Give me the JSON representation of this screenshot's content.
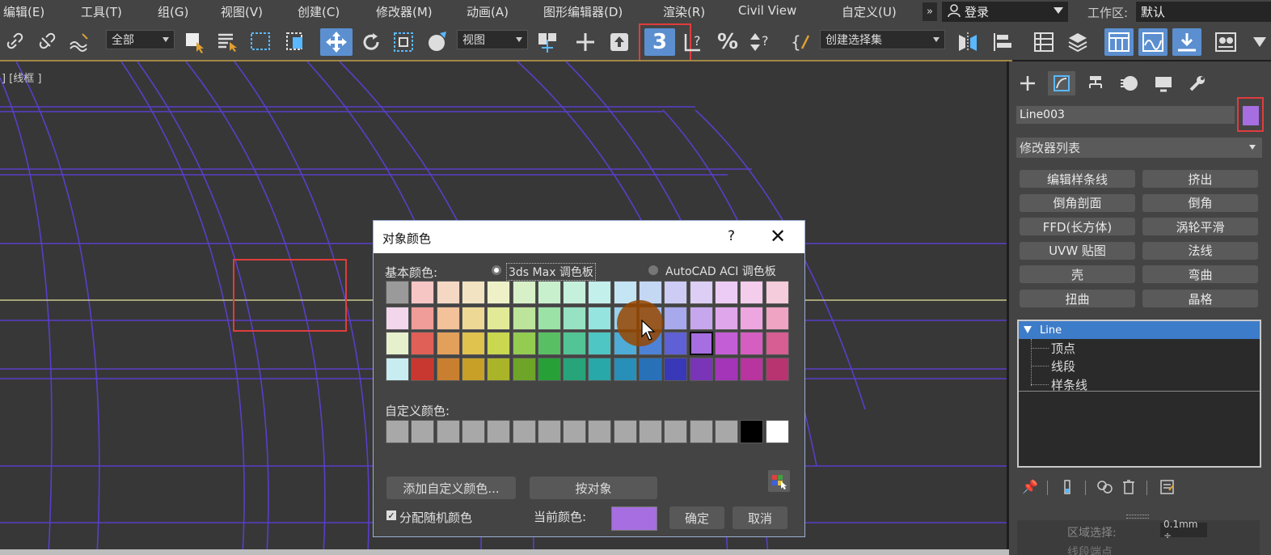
{
  "menu": {
    "items": [
      "编辑(E)",
      "工具(T)",
      "组(G)",
      "视图(V)",
      "创建(C)",
      "修改器(M)",
      "动画(A)",
      "图形编辑器(D)",
      "渲染(R)",
      "Civil View",
      "自定义(U)"
    ],
    "more": "»",
    "login": "登录",
    "workspace_label": "工作区:",
    "workspace_value": "默认"
  },
  "toolbar": {
    "filter_dropdown": "全部",
    "refcoord_dropdown": "视图",
    "selection_set_dropdown": "创建选择集",
    "snap_toggle_label": "3"
  },
  "viewport": {
    "label": "] [线框 ]"
  },
  "command_panel": {
    "object_name": "Line003",
    "object_color": "#a66ee0",
    "modifier_list": "修改器列表",
    "modifier_buttons": [
      "编辑样条线",
      "挤出",
      "倒角剖面",
      "倒角",
      "FFD(长方体)",
      "涡轮平滑",
      "UVW 贴图",
      "法线",
      "壳",
      "弯曲",
      "扭曲",
      "晶格"
    ],
    "stack": {
      "selected": "Line",
      "sub_objects": [
        "顶点",
        "线段",
        "样条线"
      ]
    },
    "region_select_label": "区域选择:",
    "region_select_value": "0.1mm ÷",
    "next_label": "线段端点"
  },
  "dialog": {
    "title": "对象颜色",
    "help": "?",
    "close": "✕",
    "basic_colors_label": "基本颜色:",
    "option_max": "3ds Max 调色板",
    "option_aci": "AutoCAD ACI 调色板",
    "palette_rows": [
      [
        "#9a9a9a",
        "#f5c6c4",
        "#f5d8c4",
        "#f2e4c2",
        "#eef0c8",
        "#d8f0c8",
        "#c8f0cc",
        "#c4f0dc",
        "#c4f0ec",
        "#c4e6f4",
        "#c4d8f4",
        "#ccccf4",
        "#dccef4",
        "#ecccf4",
        "#f4ccec",
        "#f4ccdc"
      ],
      [
        "#f2d6ec",
        "#f09c98",
        "#f3c29a",
        "#eed896",
        "#e2ea98",
        "#bce49a",
        "#9ae2a6",
        "#96e2c2",
        "#96e4e0",
        "#98d2ec",
        "#98b8ec",
        "#a8a8ec",
        "#c6a6ec",
        "#e0a6ec",
        "#ee a6e0",
        "#eea4c2"
      ],
      [
        "#e6f0cc",
        "#e06058",
        "#e3a05a",
        "#e0c24e",
        "#cad850",
        "#94cc52",
        "#58c062",
        "#52c496",
        "#4ec6c4",
        "#4eacd6",
        "#4e82d6",
        "#6060d6",
        "#9a5ed6",
        "#c45ed6",
        "#d65ec0",
        "#d65e92"
      ],
      [
        "#c8ecf0",
        "#c83830",
        "#c88030",
        "#c8a028",
        "#aab428",
        "#6ea428",
        "#28a038",
        "#28a47a",
        "#28a8a8",
        "#2890b8",
        "#2870b8",
        "#3838b8",
        "#7a34b8",
        "#a434b8",
        "#b8349e",
        "#b83470"
      ]
    ],
    "selected_swatch": "#a66ee0",
    "custom_colors_label": "自定义颜色:",
    "custom_colors": [
      "#a8a8a8",
      "#a8a8a8",
      "#a8a8a8",
      "#a8a8a8",
      "#a8a8a8",
      "#a8a8a8",
      "#a8a8a8",
      "#a8a8a8",
      "#a8a8a8",
      "#a8a8a8",
      "#a8a8a8",
      "#a8a8a8",
      "#a8a8a8",
      "#a8a8a8",
      "#000000",
      "#ffffff"
    ],
    "add_custom_button": "添加自定义颜色...",
    "by_object_button": "按对象",
    "random_colors_label": "分配随机颜色",
    "random_colors_checked": true,
    "current_color_label": "当前颜色:",
    "current_color": "#a66ee0",
    "ok_button": "确定",
    "cancel_button": "取消"
  },
  "colors": {
    "accent_blue": "#5b8fd0",
    "highlight_red": "#e03c3c",
    "wire_purple": "#5a3ec8"
  }
}
